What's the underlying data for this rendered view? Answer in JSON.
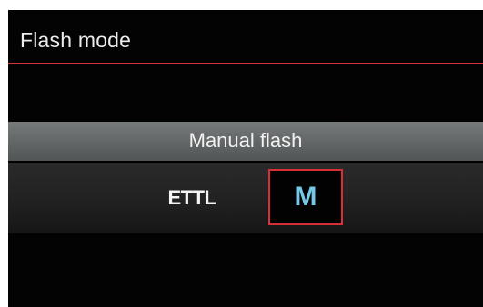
{
  "screen": {
    "title": "Flash mode",
    "mode_description": "Manual flash",
    "options": [
      {
        "label": "ETTL",
        "selected": false
      },
      {
        "label": "M",
        "selected": true
      }
    ]
  },
  "colors": {
    "accent_red": "#d72f33",
    "selected_text_blue": "#75c9e6",
    "background": "#030303"
  }
}
